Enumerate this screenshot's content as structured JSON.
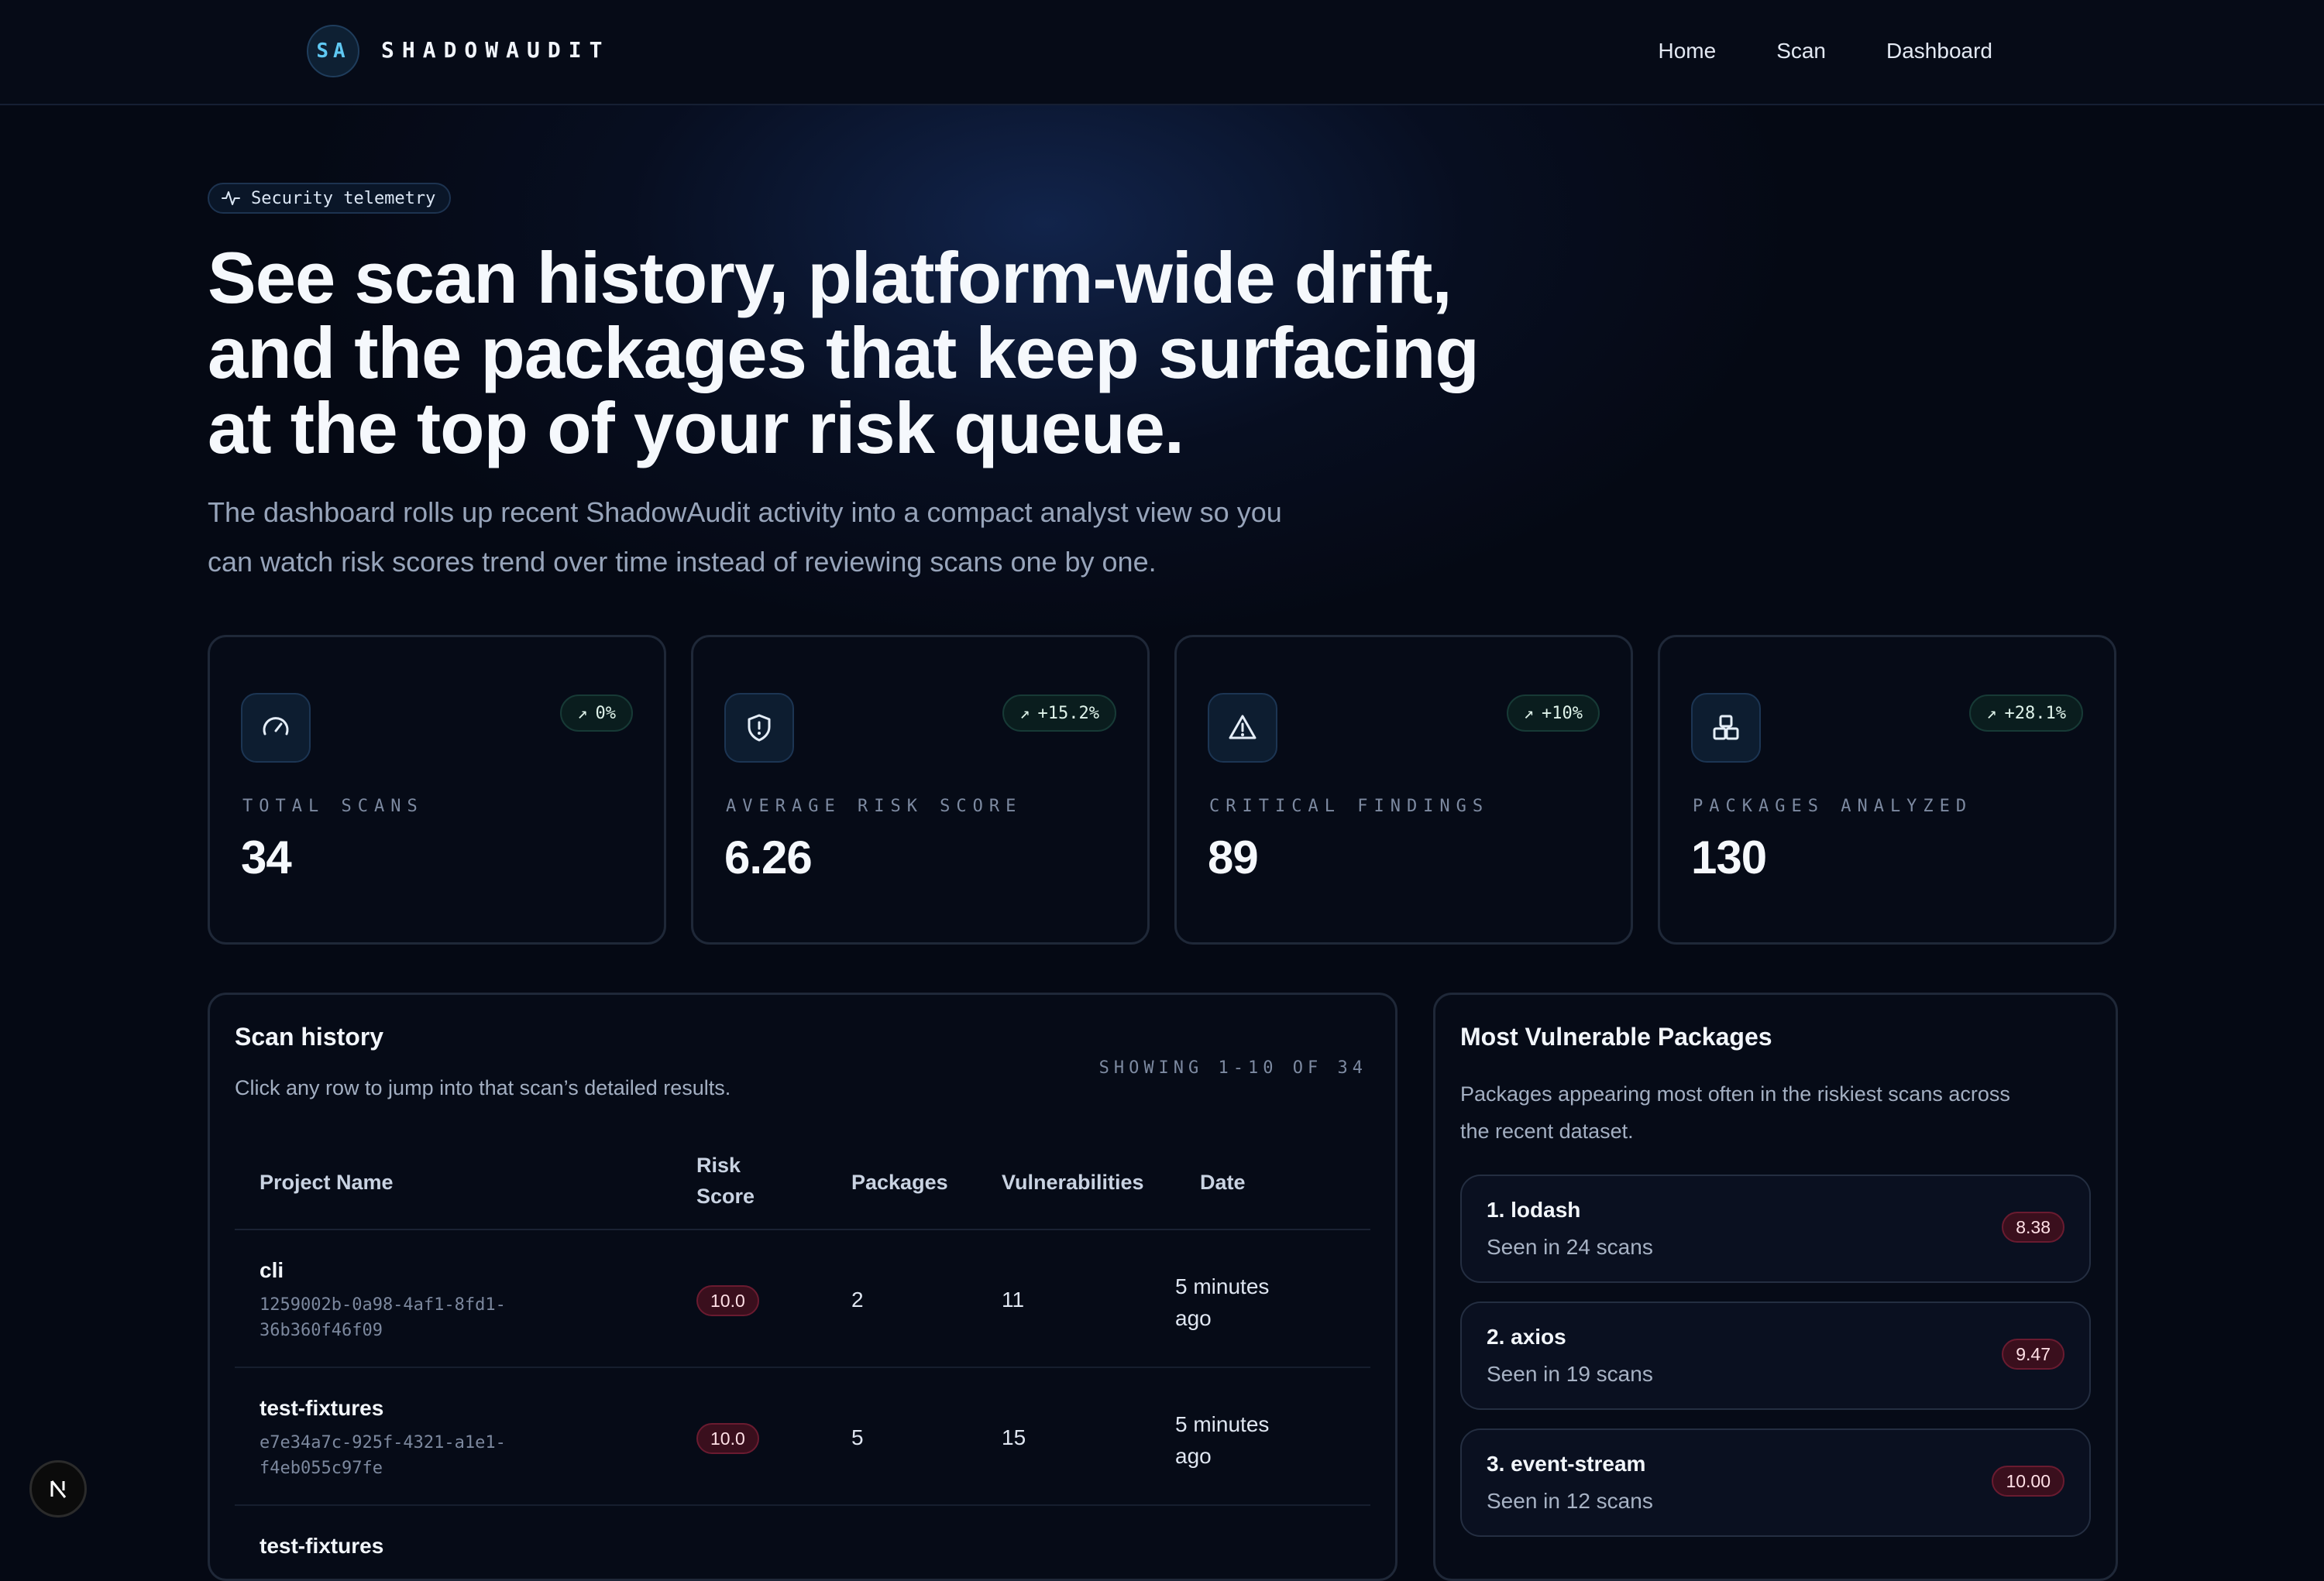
{
  "nav": {
    "logo_initials": "SA",
    "brand": "SHADOWAUDIT",
    "links": [
      "Home",
      "Scan",
      "Dashboard"
    ]
  },
  "hero": {
    "pill_label": "Security telemetry",
    "title_line1": "See scan history, platform-wide drift,",
    "title_line2": "and the packages that keep surfacing",
    "title_line3": "at the top of your risk queue.",
    "subtitle_line1": "The dashboard rolls up recent ShadowAudit activity into a compact analyst view so you",
    "subtitle_line2": "can watch risk scores trend over time instead of reviewing scans one by one."
  },
  "stats": [
    {
      "label": "TOTAL SCANS",
      "value": "34",
      "delta": "0%",
      "icon": "gauge-icon"
    },
    {
      "label": "AVERAGE RISK SCORE",
      "value": "6.26",
      "delta": "+15.2%",
      "icon": "shield-alert-icon"
    },
    {
      "label": "CRITICAL FINDINGS",
      "value": "89",
      "delta": "+10%",
      "icon": "warning-triangle-icon"
    },
    {
      "label": "PACKAGES ANALYZED",
      "value": "130",
      "delta": "+28.1%",
      "icon": "boxes-icon"
    }
  ],
  "scan_history": {
    "title": "Scan history",
    "description": "Click any row to jump into that scan’s detailed results.",
    "showing": "SHOWING 1-10 OF 34",
    "columns": {
      "project": "Project Name",
      "risk_line1": "Risk",
      "risk_line2": "Score",
      "packages": "Packages",
      "vulnerabilities": "Vulnerabilities",
      "date": "Date"
    },
    "rows": [
      {
        "name": "cli",
        "id_line1": "1259002b-0a98-4af1-8fd1-",
        "id_line2": "36b360f46f09",
        "risk": "10.0",
        "packages": "2",
        "vulnerabilities": "11",
        "date_line1": "5 minutes",
        "date_line2": "ago"
      },
      {
        "name": "test-fixtures",
        "id_line1": "e7e34a7c-925f-4321-a1e1-",
        "id_line2": "f4eb055c97fe",
        "risk": "10.0",
        "packages": "5",
        "vulnerabilities": "15",
        "date_line1": "5 minutes",
        "date_line2": "ago"
      },
      {
        "name": "test-fixtures"
      }
    ]
  },
  "vulnerable_packages": {
    "title": "Most Vulnerable Packages",
    "description_line1": "Packages appearing most often in the riskiest scans across",
    "description_line2": "the recent dataset.",
    "items": [
      {
        "name": "1. lodash",
        "seen": "Seen in 24 scans",
        "score": "8.38"
      },
      {
        "name": "2. axios",
        "seen": "Seen in 19 scans",
        "score": "9.47"
      },
      {
        "name": "3. event-stream",
        "seen": "Seen in 12 scans",
        "score": "10.00"
      }
    ]
  },
  "colors": {
    "background": "#050914",
    "accent": "#5fc8f2",
    "danger_badge": "#3a0f1d",
    "positive_badge": "#0a1d1e"
  }
}
